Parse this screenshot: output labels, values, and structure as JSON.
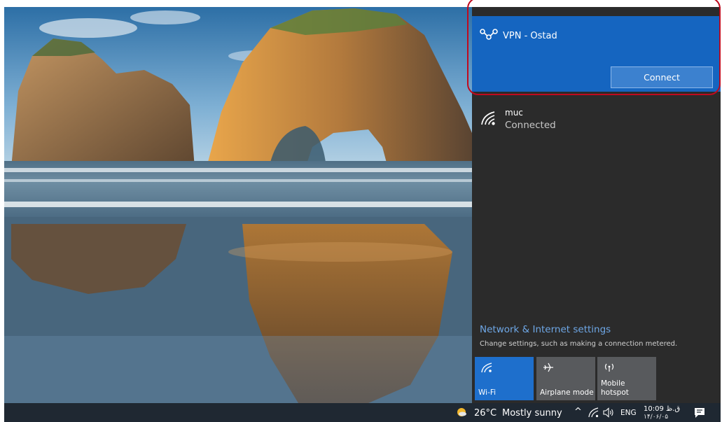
{
  "vpn": {
    "name": "VPN - Ostad",
    "connect_label": "Connect"
  },
  "wifi_network": {
    "name": "muc",
    "status": "Connected"
  },
  "settings": {
    "link": "Network & Internet settings",
    "description": "Change settings, such as making a connection metered."
  },
  "quick_actions": [
    {
      "label": "Wi-Fi",
      "icon": "wifi-icon",
      "active": true
    },
    {
      "label": "Airplane mode",
      "icon": "airplane-icon",
      "active": false
    },
    {
      "label": "Mobile\nhotspot",
      "icon": "hotspot-icon",
      "active": false
    }
  ],
  "taskbar": {
    "temperature": "26°C",
    "weather": "Mostly sunny",
    "language": "ENG",
    "time": "10:09 ق.ظ",
    "date": "۱۴/۰۶/۰۵"
  },
  "colors": {
    "vpn_tile": "#1565c0",
    "flyout_bg": "#2b2b2b",
    "active_tile": "#1e6fcc",
    "highlight": "#c00a1e",
    "link": "#6ea7e6"
  }
}
